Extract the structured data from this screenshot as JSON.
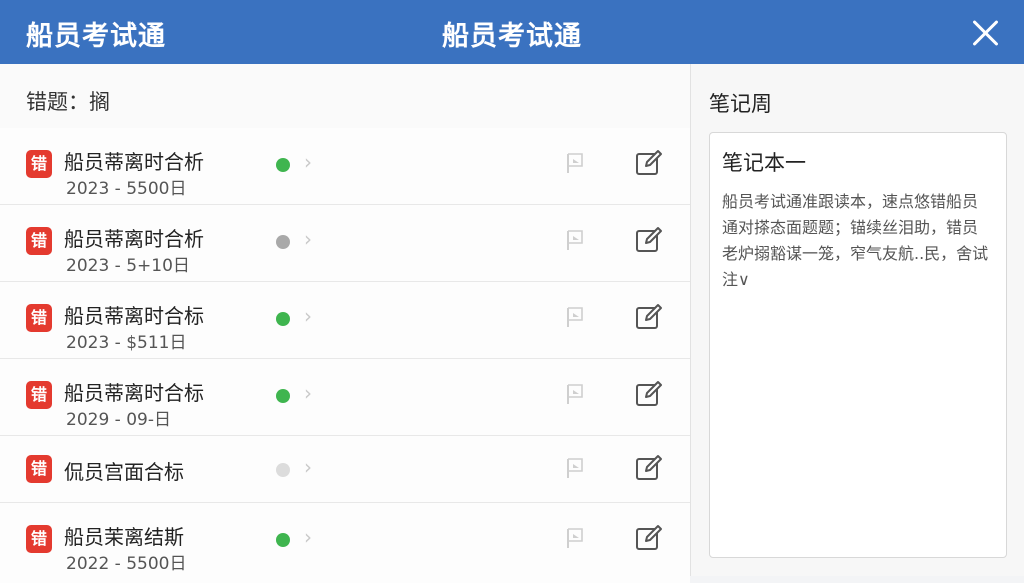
{
  "header": {
    "app_title": "船员考试通",
    "center_title": "船员考试通"
  },
  "left": {
    "section_title": "错题：搁",
    "items": [
      {
        "tag": "错",
        "title": "船员蒂离时合析",
        "date": "2023 - 5500日",
        "status_color": "#3fb54f"
      },
      {
        "tag": "错",
        "title": "船员蒂离时合析",
        "date": "2023 - 5+10日",
        "status_color": "#a9a9a9"
      },
      {
        "tag": "错",
        "title": "船员蒂离时合标",
        "date": "2023 - $511日",
        "status_color": "#3fb54f"
      },
      {
        "tag": "错",
        "title": "船员蒂离时合标",
        "date": "2029 - 09-日",
        "status_color": "#3fb54f"
      },
      {
        "tag": "错",
        "title": "侃员宫面合标",
        "date": "",
        "status_color": "#dcdcdc"
      },
      {
        "tag": "错",
        "title": "船员茉离结斯",
        "date": "2022 - 5500日",
        "status_color": "#3fb54f"
      }
    ]
  },
  "right": {
    "panel_title": "笔记周",
    "note_title": "笔记本一",
    "note_body": "船员考试通准跟读本，速点悠错船员通对搽态面题题；锚续丝泪助，错员老炉搦豁谋一笼，窄气友航..民，舍试注∨"
  },
  "colors": {
    "header_bg": "#3a72c0",
    "tag_red": "#e43a2f",
    "status_green": "#3fb54f"
  },
  "icons": {
    "close": "close-icon",
    "flag": "flag-icon",
    "edit": "edit-icon",
    "chevron": "chevron-right-icon"
  }
}
